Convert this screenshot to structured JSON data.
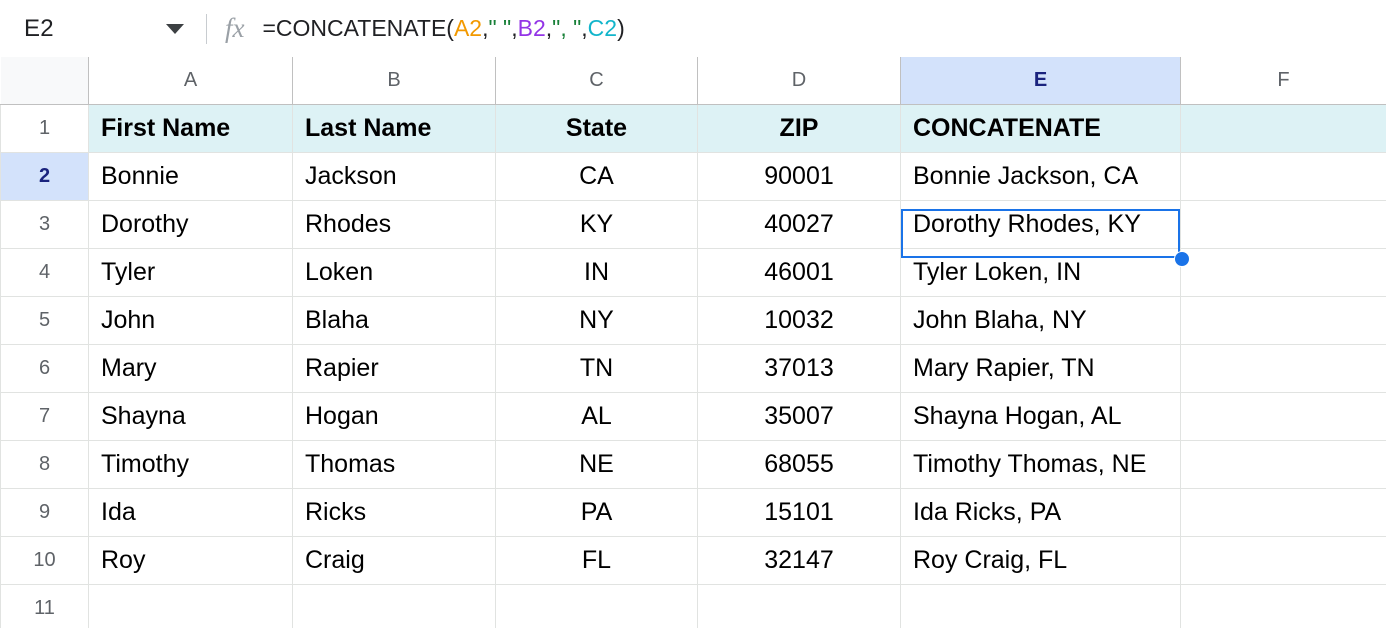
{
  "toolbar": {
    "name_box_value": "E2",
    "name_box_caret_icon": "chevron-down-icon",
    "fx_icon_label": "fx",
    "formula": {
      "full_text": "=CONCATENATE(A2,\" \",B2,\", \",C2)",
      "tokens": [
        {
          "text": "=CONCATENATE(",
          "kind": "plain"
        },
        {
          "text": "A2",
          "kind": "ref-a"
        },
        {
          "text": ",",
          "kind": "plain"
        },
        {
          "text": "\" \"",
          "kind": "str"
        },
        {
          "text": ",",
          "kind": "plain"
        },
        {
          "text": "B2",
          "kind": "ref-b"
        },
        {
          "text": ",",
          "kind": "plain"
        },
        {
          "text": "\", \"",
          "kind": "str"
        },
        {
          "text": ",",
          "kind": "plain"
        },
        {
          "text": "C2",
          "kind": "ref-c"
        },
        {
          "text": ")",
          "kind": "plain"
        }
      ],
      "t0": "=CONCATENATE(",
      "t1": "A2",
      "t2": ",",
      "t3": "\" \"",
      "t4": ",",
      "t5": "B2",
      "t6": ",",
      "t7": "\", \"",
      "t8": ",",
      "t9": "C2",
      "t10": ")"
    }
  },
  "grid": {
    "selected_cell": "E2",
    "selected_column": "E",
    "selected_row": "2",
    "column_headers": [
      "A",
      "B",
      "C",
      "D",
      "E",
      "F"
    ],
    "row_headers": [
      "1",
      "2",
      "3",
      "4",
      "5",
      "6",
      "7",
      "8",
      "9",
      "10",
      "11"
    ],
    "colors": {
      "header_fill": "#ddf2f5",
      "selection_border": "#1a73e8",
      "header_highlight": "#d3e2fb",
      "gridline": "#e1e3e1",
      "ref_a_color": "#f29900",
      "ref_b_color": "#9334e6",
      "ref_c_color": "#12b5cb",
      "string_color": "#188038"
    },
    "rows": [
      {
        "num": "1",
        "is_header": true,
        "selected": false,
        "cells": [
          {
            "text": "First Name",
            "align": "left"
          },
          {
            "text": "Last Name",
            "align": "left"
          },
          {
            "text": "State",
            "align": "center"
          },
          {
            "text": "ZIP",
            "align": "center"
          },
          {
            "text": "CONCATENATE",
            "align": "left"
          },
          {
            "text": "",
            "align": "left"
          }
        ]
      },
      {
        "num": "2",
        "is_header": false,
        "selected": true,
        "cells": [
          {
            "text": "Bonnie",
            "align": "left"
          },
          {
            "text": "Jackson",
            "align": "left"
          },
          {
            "text": "CA",
            "align": "center"
          },
          {
            "text": "90001",
            "align": "center"
          },
          {
            "text": "Bonnie Jackson, CA",
            "align": "left"
          },
          {
            "text": "",
            "align": "left"
          }
        ]
      },
      {
        "num": "3",
        "is_header": false,
        "selected": false,
        "cells": [
          {
            "text": "Dorothy",
            "align": "left"
          },
          {
            "text": "Rhodes",
            "align": "left"
          },
          {
            "text": "KY",
            "align": "center"
          },
          {
            "text": "40027",
            "align": "center"
          },
          {
            "text": "Dorothy Rhodes, KY",
            "align": "left"
          },
          {
            "text": "",
            "align": "left"
          }
        ]
      },
      {
        "num": "4",
        "is_header": false,
        "selected": false,
        "cells": [
          {
            "text": "Tyler",
            "align": "left"
          },
          {
            "text": "Loken",
            "align": "left"
          },
          {
            "text": "IN",
            "align": "center"
          },
          {
            "text": "46001",
            "align": "center"
          },
          {
            "text": "Tyler Loken, IN",
            "align": "left"
          },
          {
            "text": "",
            "align": "left"
          }
        ]
      },
      {
        "num": "5",
        "is_header": false,
        "selected": false,
        "cells": [
          {
            "text": "John",
            "align": "left"
          },
          {
            "text": "Blaha",
            "align": "left"
          },
          {
            "text": "NY",
            "align": "center"
          },
          {
            "text": "10032",
            "align": "center"
          },
          {
            "text": "John Blaha, NY",
            "align": "left"
          },
          {
            "text": "",
            "align": "left"
          }
        ]
      },
      {
        "num": "6",
        "is_header": false,
        "selected": false,
        "cells": [
          {
            "text": "Mary",
            "align": "left"
          },
          {
            "text": "Rapier",
            "align": "left"
          },
          {
            "text": "TN",
            "align": "center"
          },
          {
            "text": "37013",
            "align": "center"
          },
          {
            "text": "Mary Rapier, TN",
            "align": "left"
          },
          {
            "text": "",
            "align": "left"
          }
        ]
      },
      {
        "num": "7",
        "is_header": false,
        "selected": false,
        "cells": [
          {
            "text": "Shayna",
            "align": "left"
          },
          {
            "text": "Hogan",
            "align": "left"
          },
          {
            "text": "AL",
            "align": "center"
          },
          {
            "text": "35007",
            "align": "center"
          },
          {
            "text": "Shayna Hogan, AL",
            "align": "left"
          },
          {
            "text": "",
            "align": "left"
          }
        ]
      },
      {
        "num": "8",
        "is_header": false,
        "selected": false,
        "cells": [
          {
            "text": "Timothy",
            "align": "left"
          },
          {
            "text": "Thomas",
            "align": "left"
          },
          {
            "text": "NE",
            "align": "center"
          },
          {
            "text": "68055",
            "align": "center"
          },
          {
            "text": "Timothy Thomas, NE",
            "align": "left"
          },
          {
            "text": "",
            "align": "left"
          }
        ]
      },
      {
        "num": "9",
        "is_header": false,
        "selected": false,
        "cells": [
          {
            "text": "Ida",
            "align": "left"
          },
          {
            "text": "Ricks",
            "align": "left"
          },
          {
            "text": "PA",
            "align": "center"
          },
          {
            "text": "15101",
            "align": "center"
          },
          {
            "text": "Ida Ricks, PA",
            "align": "left"
          },
          {
            "text": "",
            "align": "left"
          }
        ]
      },
      {
        "num": "10",
        "is_header": false,
        "selected": false,
        "cells": [
          {
            "text": "Roy",
            "align": "left"
          },
          {
            "text": "Craig",
            "align": "left"
          },
          {
            "text": "FL",
            "align": "center"
          },
          {
            "text": "32147",
            "align": "center"
          },
          {
            "text": "Roy Craig, FL",
            "align": "left"
          },
          {
            "text": "",
            "align": "left"
          }
        ]
      },
      {
        "num": "11",
        "is_header": false,
        "selected": false,
        "cells": [
          {
            "text": "",
            "align": "left"
          },
          {
            "text": "",
            "align": "left"
          },
          {
            "text": "",
            "align": "center"
          },
          {
            "text": "",
            "align": "center"
          },
          {
            "text": "",
            "align": "left"
          },
          {
            "text": "",
            "align": "left"
          }
        ]
      }
    ]
  }
}
